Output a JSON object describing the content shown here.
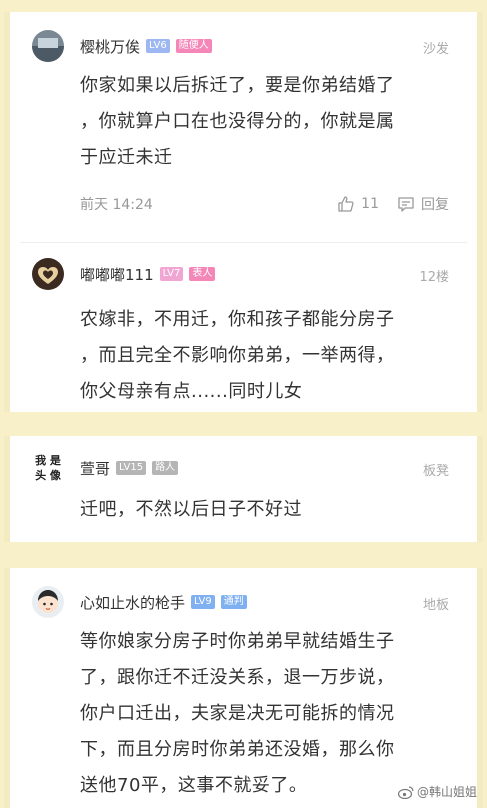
{
  "comments": [
    {
      "name": "樱桃万俟",
      "level": "LV6",
      "tag": "随便人",
      "floor": "沙发",
      "text_lines": [
        "你家如果以后拆迁了，要是你弟结婚了",
        "，你就算户口在也没得分的，你就是属",
        "于应迁未迁"
      ],
      "time": "前天 14:24",
      "likes": "11",
      "reply_label": "回复",
      "level_color": "#9db7f3",
      "tag_color": "#f487b8"
    },
    {
      "name": "嘟嘟嘟111",
      "level": "LV7",
      "tag": "表人",
      "floor": "12楼",
      "text_lines": [
        "农嫁非，不用迁，你和孩子都能分房子",
        "，而且完全不影响你弟弟，一举两得，",
        "你父母亲有点......同时儿女"
      ],
      "level_color": "#f0a5d3",
      "tag_color": "#f487b8"
    },
    {
      "name": "萱哥",
      "level": "LV15",
      "tag": "路人",
      "floor": "板凳",
      "avatar_text": [
        "我 是",
        "头 像"
      ],
      "text_lines": [
        "迁吧，不然以后日子不好过"
      ],
      "level_color": "#b5b5b5",
      "tag_color": "#b5b5b5"
    },
    {
      "name": "心如止水的枪手",
      "level": "LV9",
      "tag": "通判",
      "floor": "地板",
      "text_lines": [
        "等你娘家分房子时你弟弟早就结婚生子",
        "了，跟你迁不迁没关系，退一万步说，",
        "你户口迁出，夫家是决无可能拆的情况",
        "下，而且分房时你弟弟还没婚，那么你",
        "送他70平，这事不就妥了。"
      ],
      "level_color": "#7fb0f2",
      "tag_color": "#7fb0f2"
    }
  ],
  "watermark": "@韩山姐姐"
}
